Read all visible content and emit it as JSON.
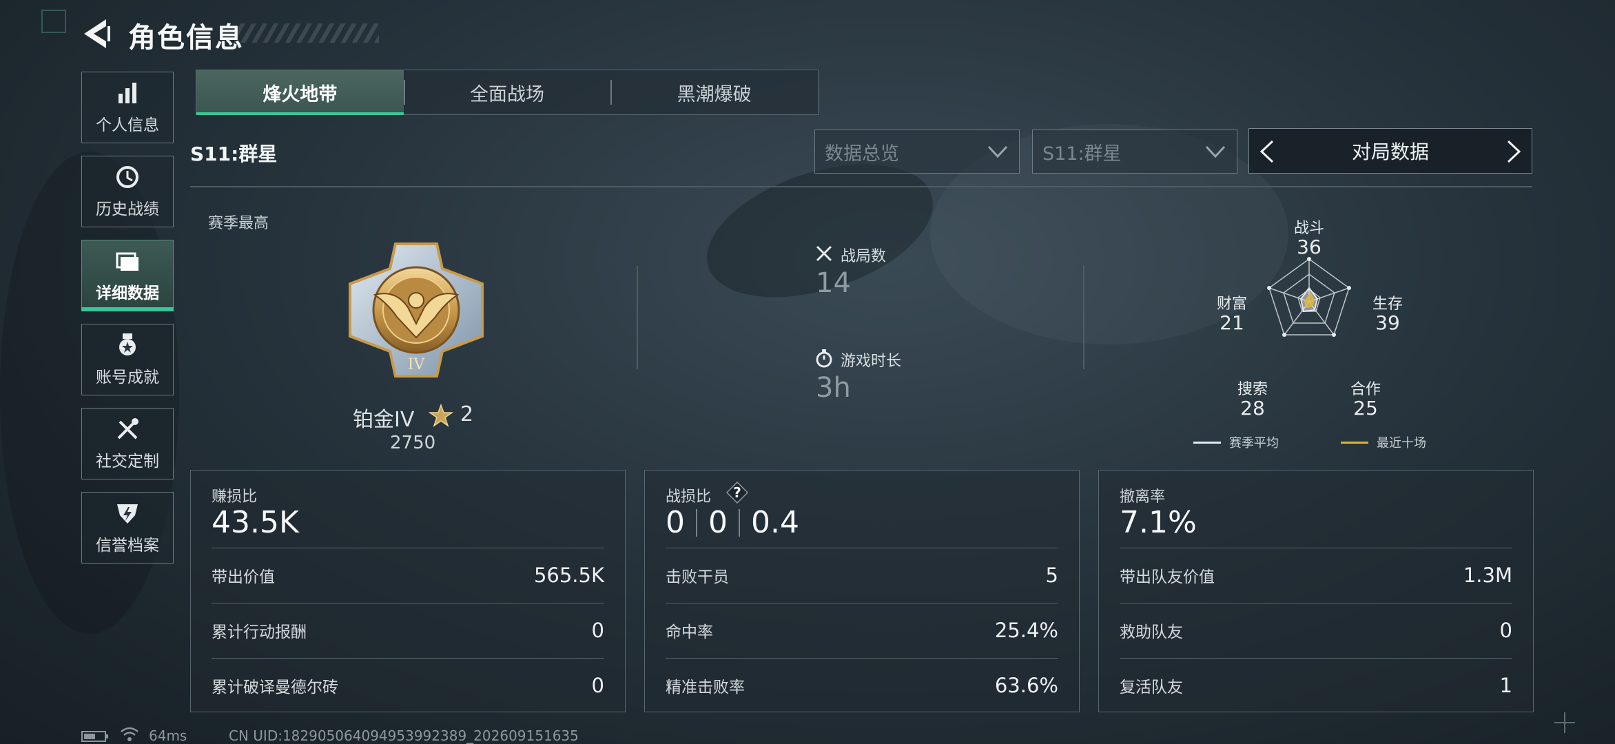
{
  "header": {
    "title": "角色信息",
    "back_icon": "back-arrow-icon"
  },
  "sidebar": {
    "items": [
      {
        "label": "个人信息",
        "icon": "bar-chart-icon",
        "active": false
      },
      {
        "label": "历史战绩",
        "icon": "clock-icon",
        "active": false
      },
      {
        "label": "详细数据",
        "icon": "folder-icon",
        "active": true
      },
      {
        "label": "账号成就",
        "icon": "medal-icon",
        "active": false
      },
      {
        "label": "社交定制",
        "icon": "tools-icon",
        "active": false
      },
      {
        "label": "信誉档案",
        "icon": "badge-icon",
        "active": false
      }
    ]
  },
  "mode_tabs": [
    {
      "label": "烽火地带",
      "active": true
    },
    {
      "label": "全面战场",
      "active": false
    },
    {
      "label": "黑潮爆破",
      "active": false
    }
  ],
  "season": {
    "label": "S11:群星"
  },
  "filters": {
    "view_select": "数据总览",
    "season_select": "S11:群星",
    "pager_label": "对局数据"
  },
  "summary": {
    "season_best_label": "赛季最高",
    "rank_name": "铂金IV",
    "rank_stars": "2",
    "rank_score": "2750",
    "matches_label": "战局数",
    "matches_value": "14",
    "playtime_label": "游戏时长",
    "playtime_value": "3h"
  },
  "radar": {
    "axes": [
      {
        "name": "战斗",
        "value": "36"
      },
      {
        "name": "生存",
        "value": "39"
      },
      {
        "name": "合作",
        "value": "25"
      },
      {
        "name": "搜索",
        "value": "28"
      },
      {
        "name": "财富",
        "value": "21"
      }
    ],
    "legend": [
      {
        "label": "赛季平均",
        "color": "#e6eaec"
      },
      {
        "label": "最近十场",
        "color": "#e0b43a"
      }
    ]
  },
  "cards": {
    "profit": {
      "title": "赚损比",
      "value": "43.5K",
      "rows": [
        {
          "label": "带出价值",
          "value": "565.5K"
        },
        {
          "label": "累计行动报酬",
          "value": "0"
        },
        {
          "label": "累计破译曼德尔砖",
          "value": "0"
        }
      ]
    },
    "combat": {
      "title": "战损比",
      "values": [
        "0",
        "0",
        "0.4"
      ],
      "rows": [
        {
          "label": "击败干员",
          "value": "5"
        },
        {
          "label": "命中率",
          "value": "25.4%"
        },
        {
          "label": "精准击败率",
          "value": "63.6%"
        }
      ]
    },
    "extract": {
      "title": "撤离率",
      "value": "7.1%",
      "rows": [
        {
          "label": "带出队友价值",
          "value": "1.3M"
        },
        {
          "label": "救助队友",
          "value": "0"
        },
        {
          "label": "复活队友",
          "value": "1"
        }
      ]
    }
  },
  "footer": {
    "ping": "64ms",
    "uid": "CN UID:1829050640949539923​89_202609151635"
  },
  "colors": {
    "accent": "#38c79a",
    "gold": "#e0b43a"
  }
}
